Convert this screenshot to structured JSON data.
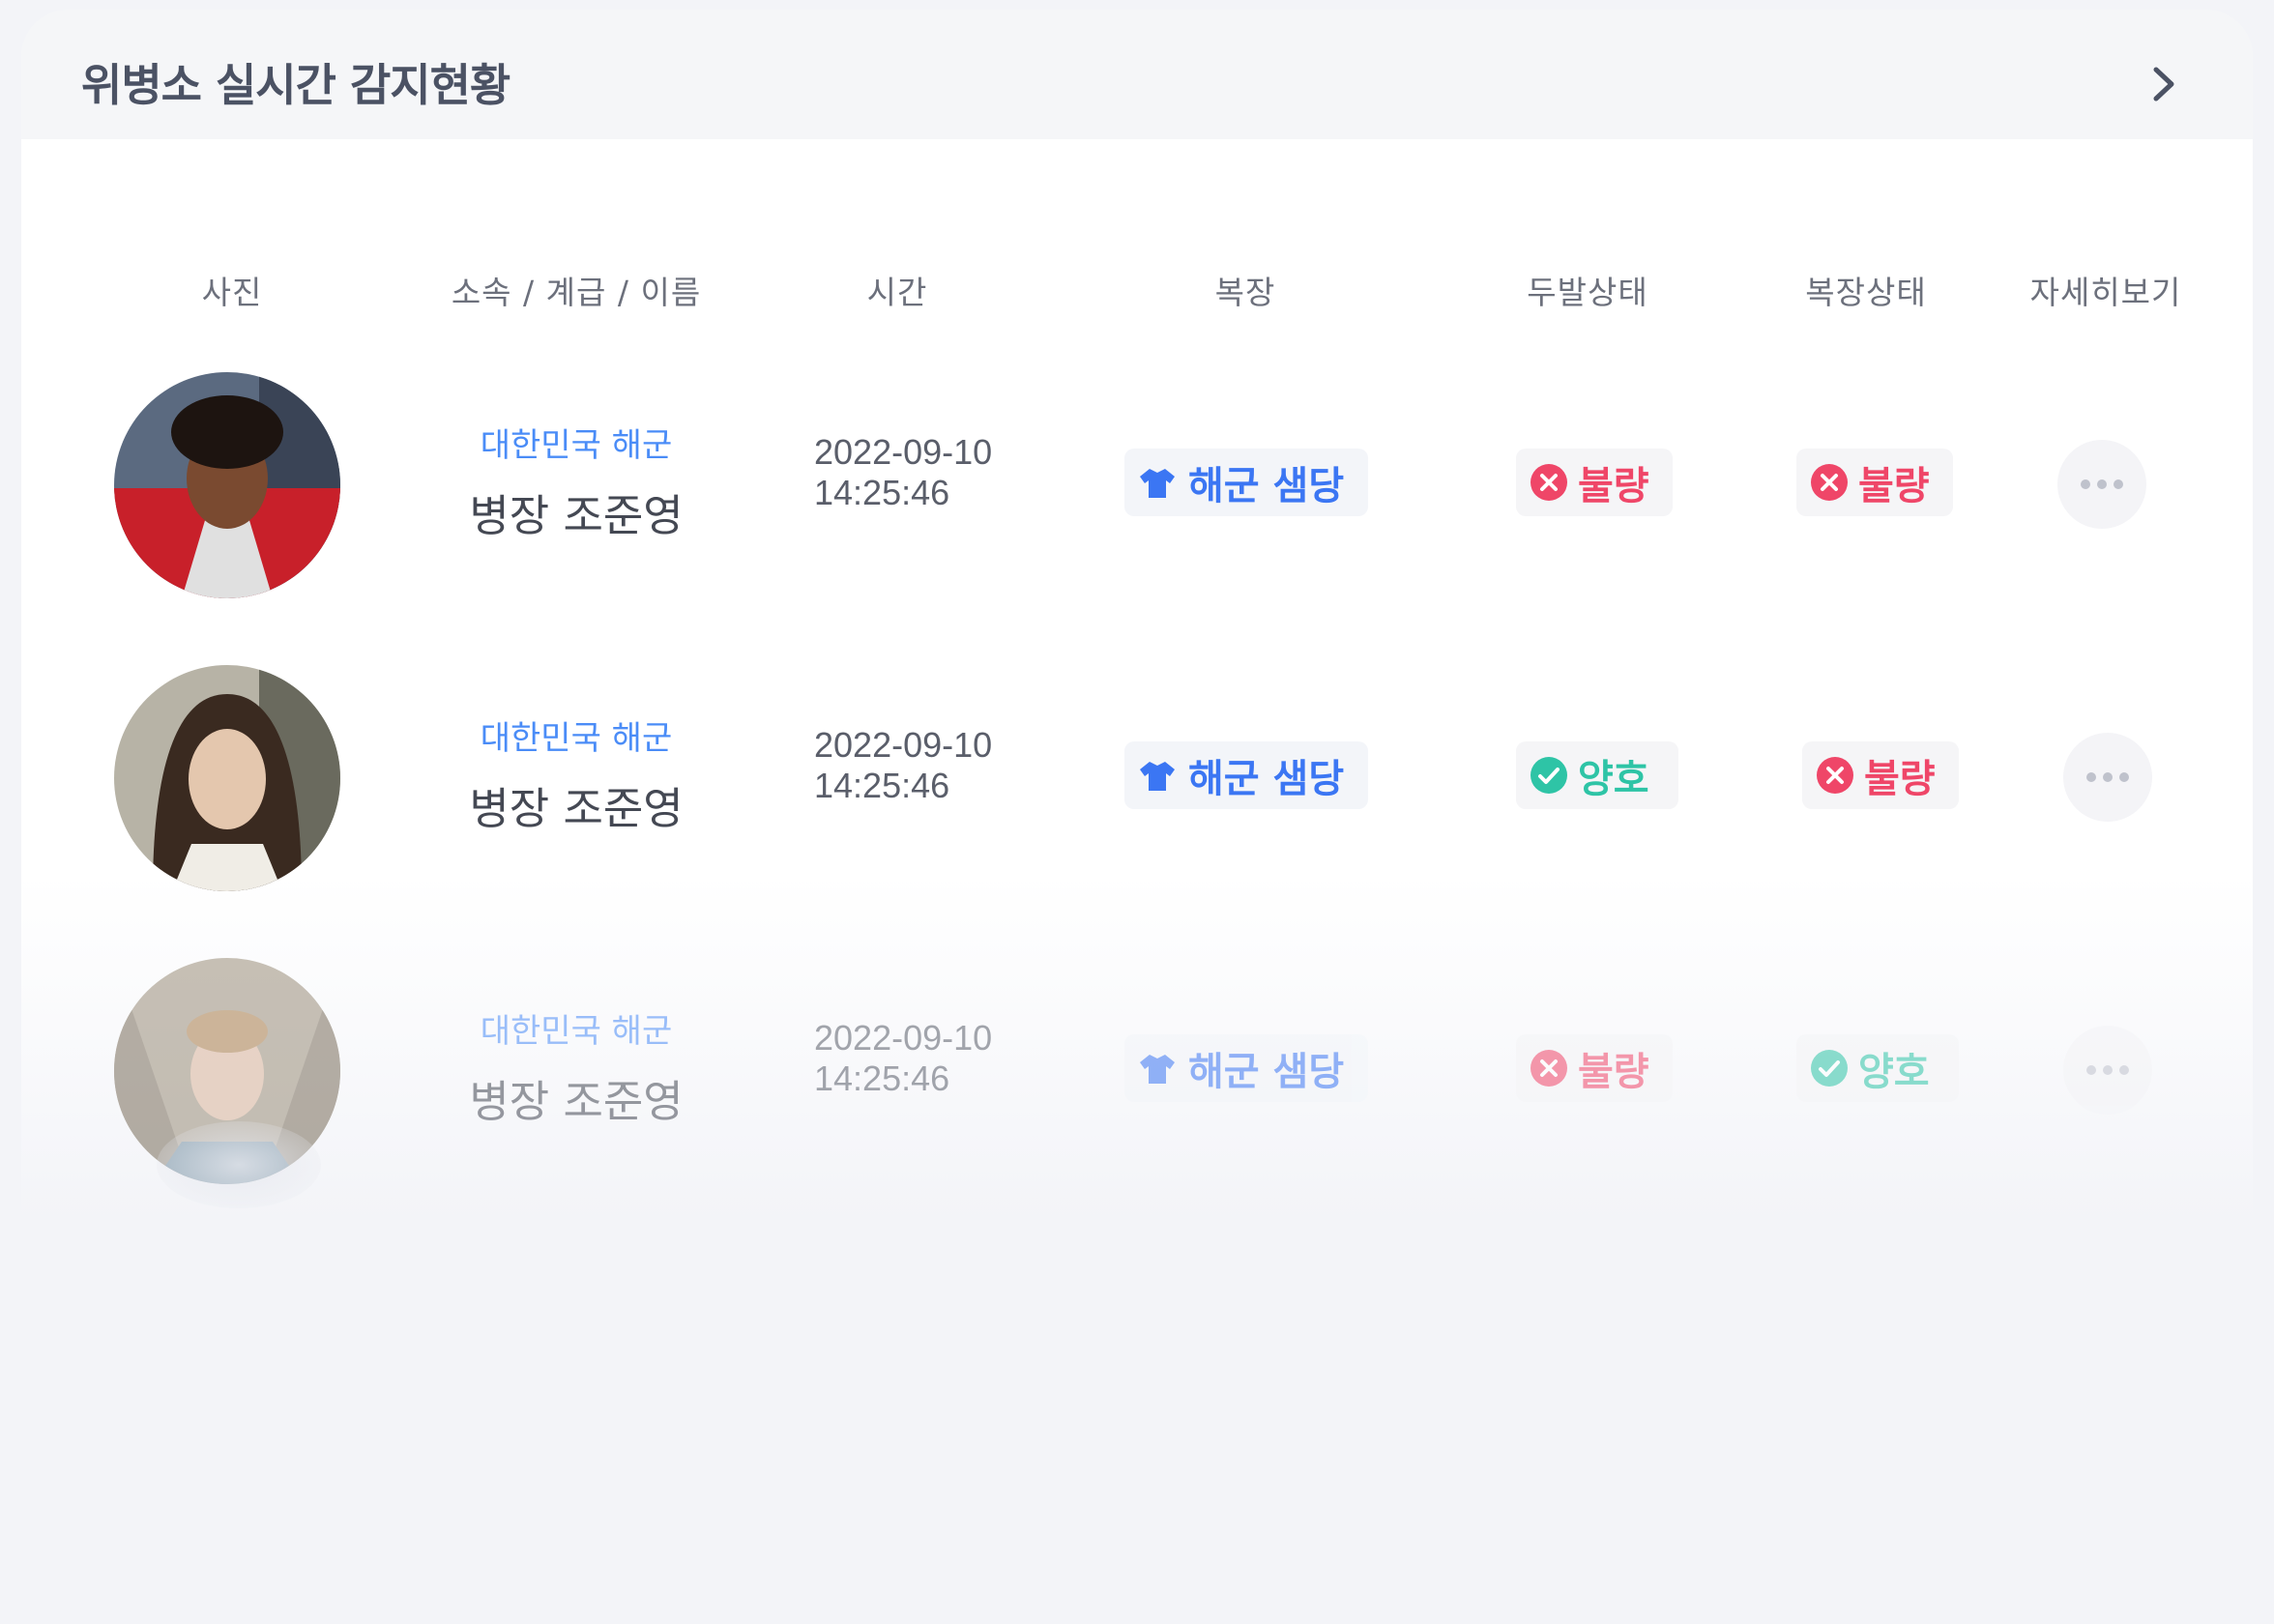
{
  "card": {
    "title": "위병소 실시간 감지현황"
  },
  "columns": {
    "photo": "사진",
    "affiliation": "소속 / 계급 / 이름",
    "time": "시간",
    "uniform": "복장",
    "hair_status": "두발상태",
    "uniform_status": "복장상태",
    "details": "자세히보기"
  },
  "rows": [
    {
      "unit": "대한민국 해군",
      "rank_name": "병장 조준영",
      "date": "2022-09-10",
      "time": "14:25:46",
      "uniform": "해군 샘당",
      "hair_status": "불량",
      "uniform_status": "불량"
    },
    {
      "unit": "대한민국 해군",
      "rank_name": "병장 조준영",
      "date": "2022-09-10",
      "time": "14:25:46",
      "uniform": "해군 샘당",
      "hair_status": "양호",
      "uniform_status": "불량"
    },
    {
      "unit": "대한민국 해군",
      "rank_name": "병장 조준영",
      "date": "2022-09-10",
      "time": "14:25:46",
      "uniform": "해군 샘당",
      "hair_status": "불량",
      "uniform_status": "양호"
    }
  ],
  "colors": {
    "accent_blue": "#3b76f3",
    "unit_blue": "#4a8cf7",
    "bad_red": "#ef4668",
    "good_green": "#2ec4a6"
  },
  "icons": {
    "header_arrow": "chevron-right-icon",
    "uniform": "shirt-icon",
    "bad": "x-circle-icon",
    "good": "check-circle-icon",
    "details": "more-dots-icon"
  }
}
